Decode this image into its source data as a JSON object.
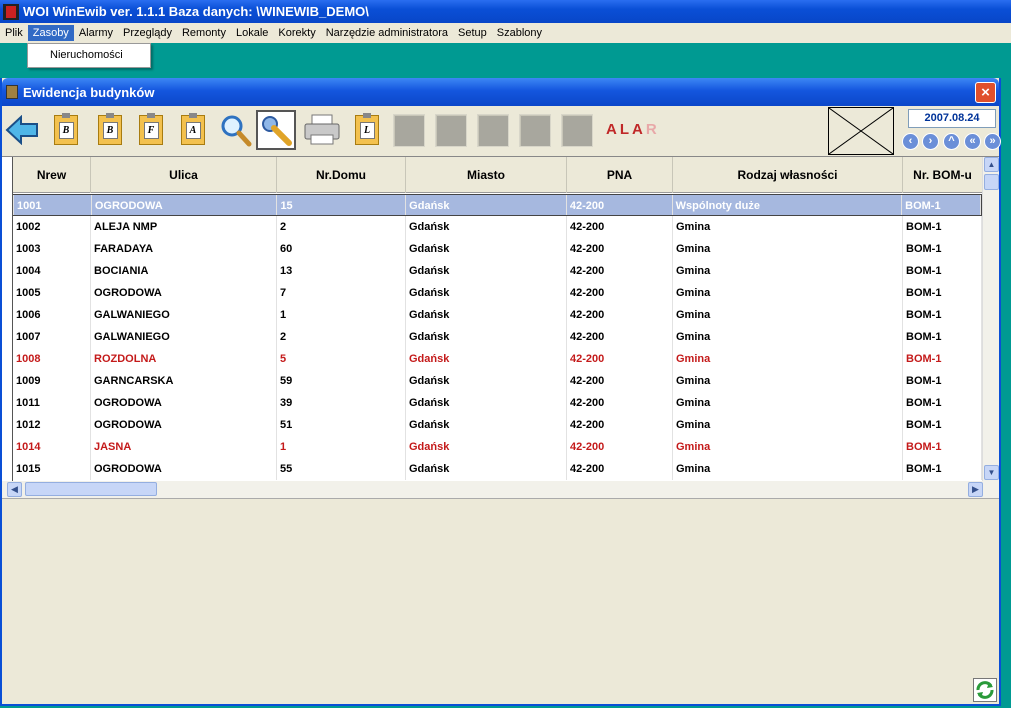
{
  "app": {
    "title": "WOI WinEwib ver. 1.1.1  Baza danych: \\WINEWIB_DEMO\\"
  },
  "menu": {
    "items": [
      "Plik",
      "Zasoby",
      "Alarmy",
      "Przeglądy",
      "Remonty",
      "Lokale",
      "Korekty",
      "Narzędzie administratora",
      "Setup",
      "Szablony"
    ],
    "active": "Zasoby",
    "dropdown": [
      "Nieruchomości"
    ]
  },
  "window": {
    "title": "Ewidencja budynków",
    "close_label": "×"
  },
  "toolbar": {
    "buttons": [
      {
        "icon": "back-arrow-icon"
      },
      {
        "icon": "clipboard-b-icon",
        "letter": "B"
      },
      {
        "icon": "clipboard-copy-b-icon",
        "letter": "B"
      },
      {
        "icon": "clipboard-f-icon",
        "letter": "F"
      },
      {
        "icon": "clipboard-a-icon",
        "letter": "A"
      },
      {
        "icon": "magnifier-icon"
      },
      {
        "icon": "wrench-icon"
      },
      {
        "icon": "printer-icon"
      },
      {
        "icon": "clipboard-l-icon",
        "letter": "L"
      }
    ],
    "alarm_label_main": "ALA",
    "alarm_label_dim": "R",
    "date": "2007.08.24"
  },
  "grid": {
    "columns": [
      "Nrew",
      "Ulica",
      "Nr.Domu",
      "Miasto",
      "PNA",
      "Rodzaj własności",
      "Nr. BOM-u"
    ],
    "rows": [
      {
        "nrew": "1001",
        "ulica": "OGRODOWA",
        "nr": "15",
        "miasto": "Gdańsk",
        "pna": "42-200",
        "rodzaj": "Wspólnoty duże",
        "bom": "BOM-1",
        "state": "selected"
      },
      {
        "nrew": "1002",
        "ulica": "ALEJA NMP",
        "nr": "2",
        "miasto": "Gdańsk",
        "pna": "42-200",
        "rodzaj": "Gmina",
        "bom": "BOM-1",
        "state": "normal"
      },
      {
        "nrew": "1003",
        "ulica": "FARADAYA",
        "nr": "60",
        "miasto": "Gdańsk",
        "pna": "42-200",
        "rodzaj": "Gmina",
        "bom": "BOM-1",
        "state": "normal"
      },
      {
        "nrew": "1004",
        "ulica": "BOCIANIA",
        "nr": "13",
        "miasto": "Gdańsk",
        "pna": "42-200",
        "rodzaj": "Gmina",
        "bom": "BOM-1",
        "state": "normal"
      },
      {
        "nrew": "1005",
        "ulica": "OGRODOWA",
        "nr": "7",
        "miasto": "Gdańsk",
        "pna": "42-200",
        "rodzaj": "Gmina",
        "bom": "BOM-1",
        "state": "normal"
      },
      {
        "nrew": "1006",
        "ulica": "GALWANIEGO",
        "nr": "1",
        "miasto": "Gdańsk",
        "pna": "42-200",
        "rodzaj": "Gmina",
        "bom": "BOM-1",
        "state": "normal"
      },
      {
        "nrew": "1007",
        "ulica": "GALWANIEGO",
        "nr": "2",
        "miasto": "Gdańsk",
        "pna": "42-200",
        "rodzaj": "Gmina",
        "bom": "BOM-1",
        "state": "normal"
      },
      {
        "nrew": "1008",
        "ulica": "ROZDOLNA",
        "nr": "5",
        "miasto": "Gdańsk",
        "pna": "42-200",
        "rodzaj": "Gmina",
        "bom": "BOM-1",
        "state": "red"
      },
      {
        "nrew": "1009",
        "ulica": "GARNCARSKA",
        "nr": "59",
        "miasto": "Gdańsk",
        "pna": "42-200",
        "rodzaj": "Gmina",
        "bom": "BOM-1",
        "state": "normal"
      },
      {
        "nrew": "1011",
        "ulica": "OGRODOWA",
        "nr": "39",
        "miasto": "Gdańsk",
        "pna": "42-200",
        "rodzaj": "Gmina",
        "bom": "BOM-1",
        "state": "normal"
      },
      {
        "nrew": "1012",
        "ulica": "OGRODOWA",
        "nr": "51",
        "miasto": "Gdańsk",
        "pna": "42-200",
        "rodzaj": "Gmina",
        "bom": "BOM-1",
        "state": "normal"
      },
      {
        "nrew": "1014",
        "ulica": "JASNA",
        "nr": "1",
        "miasto": "Gdańsk",
        "pna": "42-200",
        "rodzaj": "Gmina",
        "bom": "BOM-1",
        "state": "red"
      },
      {
        "nrew": "1015",
        "ulica": "OGRODOWA",
        "nr": "55",
        "miasto": "Gdańsk",
        "pna": "42-200",
        "rodzaj": "Gmina",
        "bom": "BOM-1",
        "state": "normal"
      }
    ]
  },
  "colors": {
    "desktop": "#009a92",
    "selection": "#a6b8df",
    "alert_text": "#c41a1a"
  }
}
